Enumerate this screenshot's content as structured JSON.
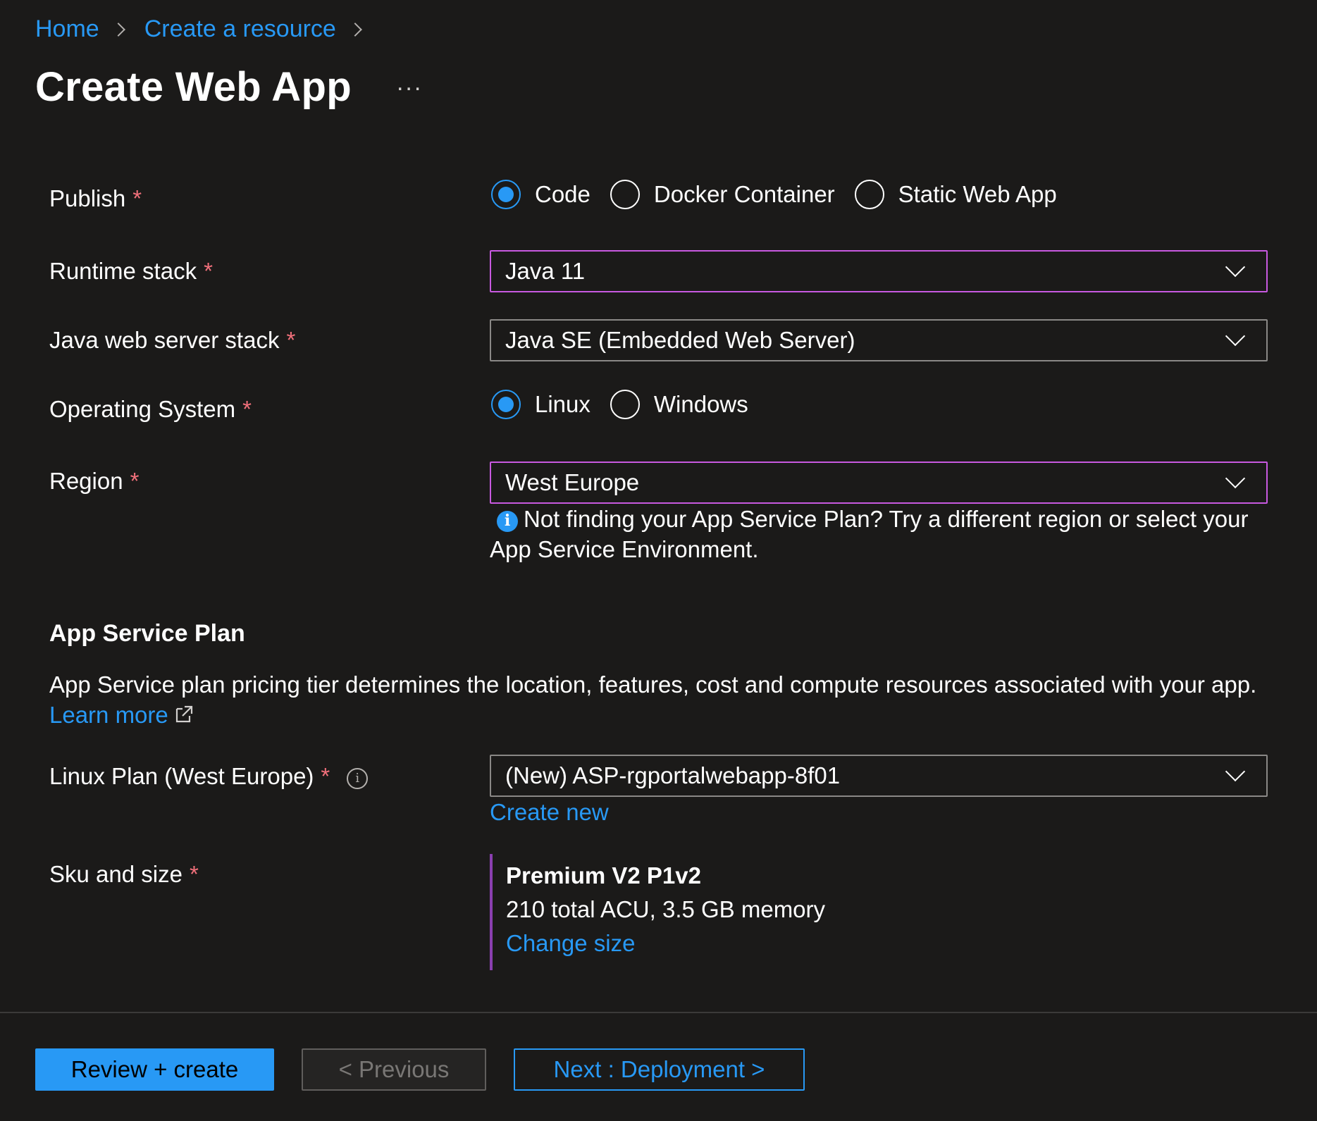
{
  "breadcrumb": {
    "home": "Home",
    "create_resource": "Create a resource"
  },
  "page": {
    "title": "Create Web App",
    "more": "..."
  },
  "form": {
    "required_mark": "*",
    "publish": {
      "label": "Publish",
      "options": [
        "Code",
        "Docker Container",
        "Static Web App"
      ],
      "selected": "Code"
    },
    "runtime_stack": {
      "label": "Runtime stack",
      "value": "Java 11"
    },
    "java_server": {
      "label": "Java web server stack",
      "value": "Java SE (Embedded Web Server)"
    },
    "os": {
      "label": "Operating System",
      "options": [
        "Linux",
        "Windows"
      ],
      "selected": "Linux"
    },
    "region": {
      "label": "Region",
      "value": "West Europe",
      "info": "Not finding your App Service Plan? Try a different region or select your App Service Environment."
    }
  },
  "plan_section": {
    "title": "App Service Plan",
    "description": "App Service plan pricing tier determines the location, features, cost and compute resources associated with your app.",
    "learn_more": "Learn more",
    "linux_plan": {
      "label": "Linux Plan (West Europe)",
      "value": "(New) ASP-rgportalwebapp-8f01",
      "create_new": "Create new"
    },
    "sku": {
      "label": "Sku and size",
      "name": "Premium V2 P1v2",
      "detail": "210 total ACU, 3.5 GB memory",
      "change": "Change size"
    }
  },
  "footer": {
    "review": "Review + create",
    "previous": "< Previous",
    "next": "Next : Deployment >"
  },
  "colors": {
    "background": "#1b1a19",
    "accent": "#2899f5",
    "required": "#f1707b",
    "focus_border": "#c859e0",
    "sku_bar": "#8a3fb0"
  }
}
